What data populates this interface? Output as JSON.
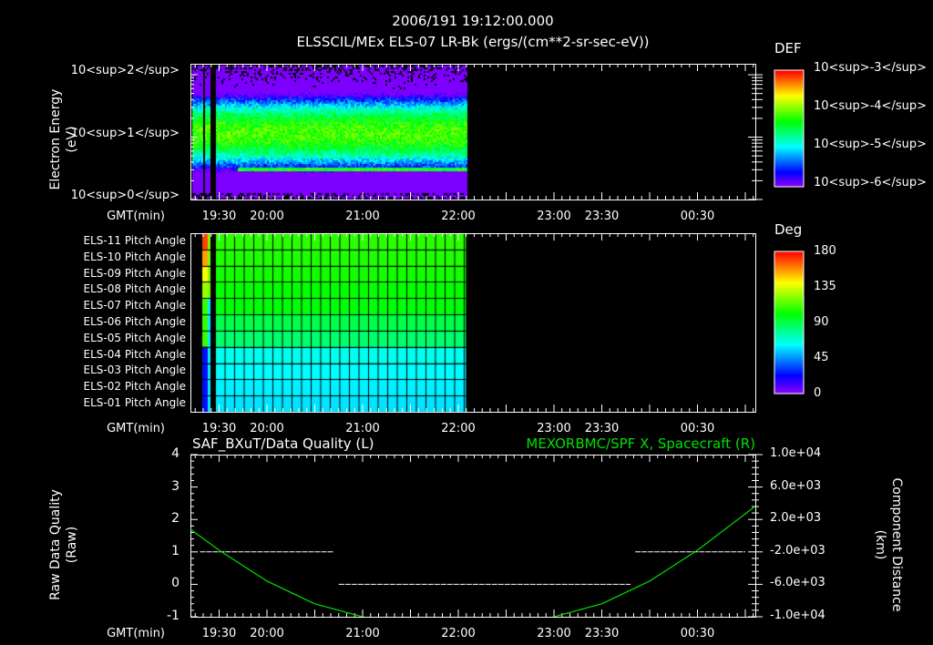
{
  "header": {
    "datetime": "2006/191 19:12:00.000",
    "title": "ELSSCIL/MEx ELS-07 LR-Bk  (ergs/(cm**2-sr-sec-eV))"
  },
  "colors": {
    "background": "#000000",
    "axis": "#ffffff",
    "series_green": "#00ff00"
  },
  "chart_data": [
    {
      "type": "heatmap",
      "title": "ELSSCIL/MEx ELS-07 LR-Bk (ergs/(cm**2-sr-sec-eV))",
      "ylabel": "Electron Energy",
      "yunit": "(eV)",
      "yscale": "log",
      "ylim": [
        1,
        150
      ],
      "yticks": [
        "10^0",
        "10^1",
        "10^2"
      ],
      "xlabel": "GMT(min)",
      "xrange_hours": [
        19.2,
        25.1
      ],
      "data_end_hour": 22.08,
      "colorbar": {
        "label": "DEF",
        "scale": "log",
        "range": [
          1e-06,
          0.001
        ],
        "ticks": [
          {
            "b": "10",
            "e": "-3"
          },
          {
            "b": "10",
            "e": "-4"
          },
          {
            "b": "10",
            "e": "-5"
          },
          {
            "b": "10",
            "e": "-6"
          }
        ]
      },
      "peak_energy_band_eV": [
        6,
        25
      ],
      "secondary_band_eV": 3.2
    },
    {
      "type": "heatmap",
      "title": "Pitch Angle",
      "rows": [
        "ELS-11 Pitch Angle",
        "ELS-10 Pitch Angle",
        "ELS-09 Pitch Angle",
        "ELS-08 Pitch Angle",
        "ELS-07 Pitch Angle",
        "ELS-06 Pitch Angle",
        "ELS-05 Pitch Angle",
        "ELS-04 Pitch Angle",
        "ELS-03 Pitch Angle",
        "ELS-02 Pitch Angle",
        "ELS-01 Pitch Angle"
      ],
      "row_values_deg": [
        108,
        106,
        104,
        102,
        100,
        90,
        85,
        65,
        62,
        60,
        58
      ],
      "xlabel": "GMT(min)",
      "data_end_hour": 22.08,
      "colorbar": {
        "label": "Deg",
        "range": [
          0,
          180
        ],
        "ticks": [
          "180",
          "135",
          "90",
          "45",
          "0"
        ]
      }
    },
    {
      "type": "line",
      "title_left": "SAF_BXuT/Data Quality (L)",
      "title_right": "MEXORBMC/SPF X, Spacecraft (R)",
      "ylabel_left": "Raw Data Quality",
      "yunit_left": "(Raw)",
      "ylim_left": [
        -1,
        4
      ],
      "yticks_left": [
        "4",
        "3",
        "2",
        "1",
        "0",
        "-1"
      ],
      "ylabel_right": "Component Distance",
      "yunit_right": "(km)",
      "ylim_right": [
        -10000,
        10000
      ],
      "yticks_right": [
        "1.0e+04",
        "6.0e+03",
        "2.0e+03",
        "-2.0e+03",
        "-6.0e+03",
        "-1.0e+04"
      ],
      "xlabel": "GMT(min)",
      "series": [
        {
          "name": "Data Quality",
          "axis": "left",
          "segments": [
            {
              "from": 19.3,
              "to": 20.7,
              "value": 1
            },
            {
              "from": 20.75,
              "to": 23.8,
              "value": 0
            },
            {
              "from": 23.85,
              "to": 25.0,
              "value": 1
            }
          ]
        },
        {
          "name": "SPF X",
          "axis": "right",
          "x": [
            19.2,
            19.5,
            20.0,
            20.5,
            21.0,
            21.5,
            22.0,
            22.5,
            23.0,
            23.5,
            24.0,
            24.5,
            25.1
          ],
          "values": [
            800,
            -1800,
            -5600,
            -8400,
            -10000,
            -11200,
            -11600,
            -11200,
            -10000,
            -8400,
            -5600,
            -1800,
            3600
          ]
        }
      ]
    }
  ],
  "xaxis": {
    "label": "GMT(min)",
    "ticks": [
      {
        "h": 19.5,
        "label": "19:30"
      },
      {
        "h": 20.0,
        "label": "20:00"
      },
      {
        "h": 21.0,
        "label": "21:00"
      },
      {
        "h": 22.0,
        "label": "22:00"
      },
      {
        "h": 23.0,
        "label": "23:00"
      },
      {
        "h": 23.5,
        "label": "23:30"
      },
      {
        "h": 24.5,
        "label": "00:30"
      }
    ],
    "panel_ticks_shown": [
      [
        "19:30",
        "20:00",
        "21:00",
        "22:00",
        "23:00",
        "23:30",
        "00:30"
      ],
      [
        "19:30",
        "20:00",
        "21:00",
        "22:00",
        "23:00",
        "23:30",
        "00:30"
      ],
      [
        "19:30",
        "20:00",
        "21:00",
        "22:00",
        "23:00",
        "23:30",
        "00:30"
      ]
    ]
  }
}
